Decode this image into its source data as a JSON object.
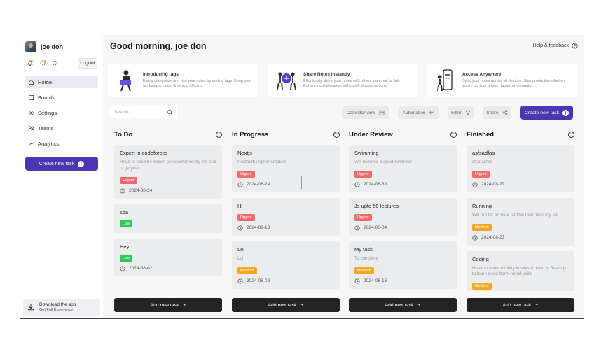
{
  "user": {
    "name": "joe don",
    "logout": "Logout"
  },
  "nav": [
    {
      "label": "Home",
      "icon": "home-icon"
    },
    {
      "label": "Boards",
      "icon": "board-icon"
    },
    {
      "label": "Settings",
      "icon": "gear-icon"
    },
    {
      "label": "Teams",
      "icon": "team-icon"
    },
    {
      "label": "Analytics",
      "icon": "chart-icon"
    }
  ],
  "sidebar_create": "Create new task",
  "download": {
    "title": "Download the app",
    "subtitle": "Get Full Experience"
  },
  "greeting": "Good morning, joe don",
  "help": "Help & feedback",
  "features": [
    {
      "title": "Introducing tags",
      "desc": "Easily categorize and find your notes by adding tags. Keep your workspace clutter-free and efficient."
    },
    {
      "title": "Share Notes Instantly",
      "desc": "Effortlessly share your notes with others via email or link. Enhance collaboration with quick sharing options."
    },
    {
      "title": "Access Anywhere",
      "desc": "Sync your notes across all devices. Stay productive whether you're on your phone, tablet, or computer."
    }
  ],
  "toolbar": {
    "search_placeholder": "Search",
    "calendar": "Calendar view",
    "automation": "Automation",
    "filter": "Filter",
    "share": "Share",
    "create": "Create new task"
  },
  "colors": {
    "accent": "#4b36b0",
    "urgent": "#f16b6b",
    "low": "#2fc65a",
    "medium": "#f5a623"
  },
  "columns": [
    {
      "title": "To Do",
      "add": "Add new task",
      "cards": [
        {
          "title": "Expert in codeforces",
          "desc": "Have to become expert on codeforces by the end of tje year",
          "priority": "Urgent",
          "date": "2024-08-24"
        },
        {
          "title": "sda",
          "desc": "",
          "priority": "Low",
          "date": ""
        },
        {
          "title": "Hey",
          "desc": "",
          "priority": "Low",
          "date": "2024-08-02"
        }
      ]
    },
    {
      "title": "In Progress",
      "add": "Add new task",
      "cards": [
        {
          "title": "Nextjs",
          "desc": "Nextauth implementation",
          "priority": "Urgent",
          "date": "2024-08-24"
        },
        {
          "title": "Hi",
          "desc": "",
          "priority": "Urgent",
          "date": "2024-08-18"
        },
        {
          "title": "Loi",
          "desc": "Loi",
          "priority": "Medium",
          "date": "2024-08-09"
        }
      ]
    },
    {
      "title": "Under Review",
      "add": "Add new task",
      "cards": [
        {
          "title": "Swimming",
          "desc": "Will become a good swimmer",
          "priority": "Urgent",
          "date": "2024-08-30"
        },
        {
          "title": "Js upto 50 lectures",
          "desc": "",
          "priority": "Urgent",
          "date": "2024-08-04"
        },
        {
          "title": "My task",
          "desc": "To complete",
          "priority": "Medium",
          "date": "2024-08-16"
        }
      ]
    },
    {
      "title": "Finished",
      "add": "Add new task",
      "cards": [
        {
          "title": "asfsadfas",
          "desc": "sfsafasfas",
          "priority": "Urgent",
          "date": "2024-08-29"
        },
        {
          "title": "Running",
          "desc": "Will run for an hour so that I can loos my fat",
          "priority": "Medium",
          "date": "2024-08-23"
        },
        {
          "title": "Coding",
          "desc": "Have to make multimple sites in Next js React js to learn good from=ntend skills",
          "priority": "Medium",
          "date": ""
        }
      ]
    }
  ]
}
